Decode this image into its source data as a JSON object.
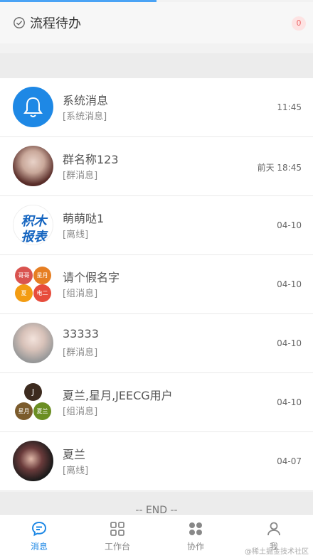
{
  "header": {
    "title": "流程待办",
    "badge": "0"
  },
  "messages": [
    {
      "name": "系统消息",
      "sub": "[系统消息]",
      "time": "11:45"
    },
    {
      "name": "群名称123",
      "sub": "[群消息]",
      "time": "前天 18:45"
    },
    {
      "name": "萌萌哒1",
      "sub": "[离线]",
      "time": "04-10",
      "avatar_text": [
        "积木",
        "报表"
      ]
    },
    {
      "name": "请个假名字",
      "sub": "[组消息]",
      "time": "04-10",
      "avatar_text": [
        "哥哥",
        "星月",
        "夏",
        "电二"
      ]
    },
    {
      "name": "33333",
      "sub": "[群消息]",
      "time": "04-10"
    },
    {
      "name": "夏兰,星月,JEECG用户",
      "sub": "[组消息]",
      "time": "04-10",
      "avatar_text": [
        "J",
        "星月",
        "夏兰"
      ]
    },
    {
      "name": "夏兰",
      "sub": "[离线]",
      "time": "04-07"
    }
  ],
  "end_text": "-- END --",
  "tabs": [
    {
      "label": "消息",
      "icon": "chat-icon",
      "active": true
    },
    {
      "label": "工作台",
      "icon": "grid-icon"
    },
    {
      "label": "协作",
      "icon": "apps-icon"
    },
    {
      "label": "我",
      "icon": "user-icon"
    }
  ],
  "watermark": "@稀土掘金技术社区",
  "colors": {
    "accent": "#1e88e5",
    "system_icon_bg": "#1e88e5"
  }
}
